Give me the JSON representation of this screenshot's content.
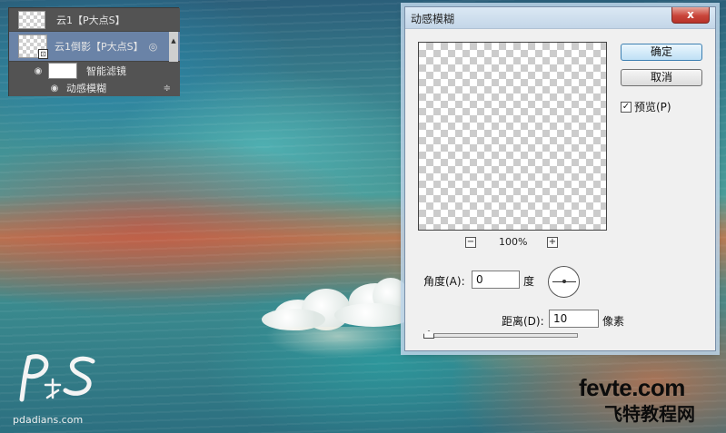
{
  "layers_panel": {
    "layer1_name": "云1【P大点S】",
    "layer2_name": "云1倒影【P大点S】",
    "smart_filters_label": "智能滤镜",
    "filter_name": "动感模糊",
    "selected_color": "#6a83a7"
  },
  "dialog": {
    "title": "动感模糊",
    "close_label": "x",
    "ok_label": "确定",
    "cancel_label": "取消",
    "preview_label": "预览(P)",
    "preview_checked": "✓",
    "zoom_minus": "−",
    "zoom_plus": "+",
    "zoom_value": "100%",
    "angle_label": "角度(A):",
    "angle_value": "0",
    "angle_unit": "度",
    "distance_label": "距离(D):",
    "distance_value": "10",
    "distance_unit": "像素"
  },
  "watermarks": {
    "ps_site": "pdadians.com",
    "fevte_site": "fevte.com",
    "fevte_cn": "飞特教程网"
  }
}
